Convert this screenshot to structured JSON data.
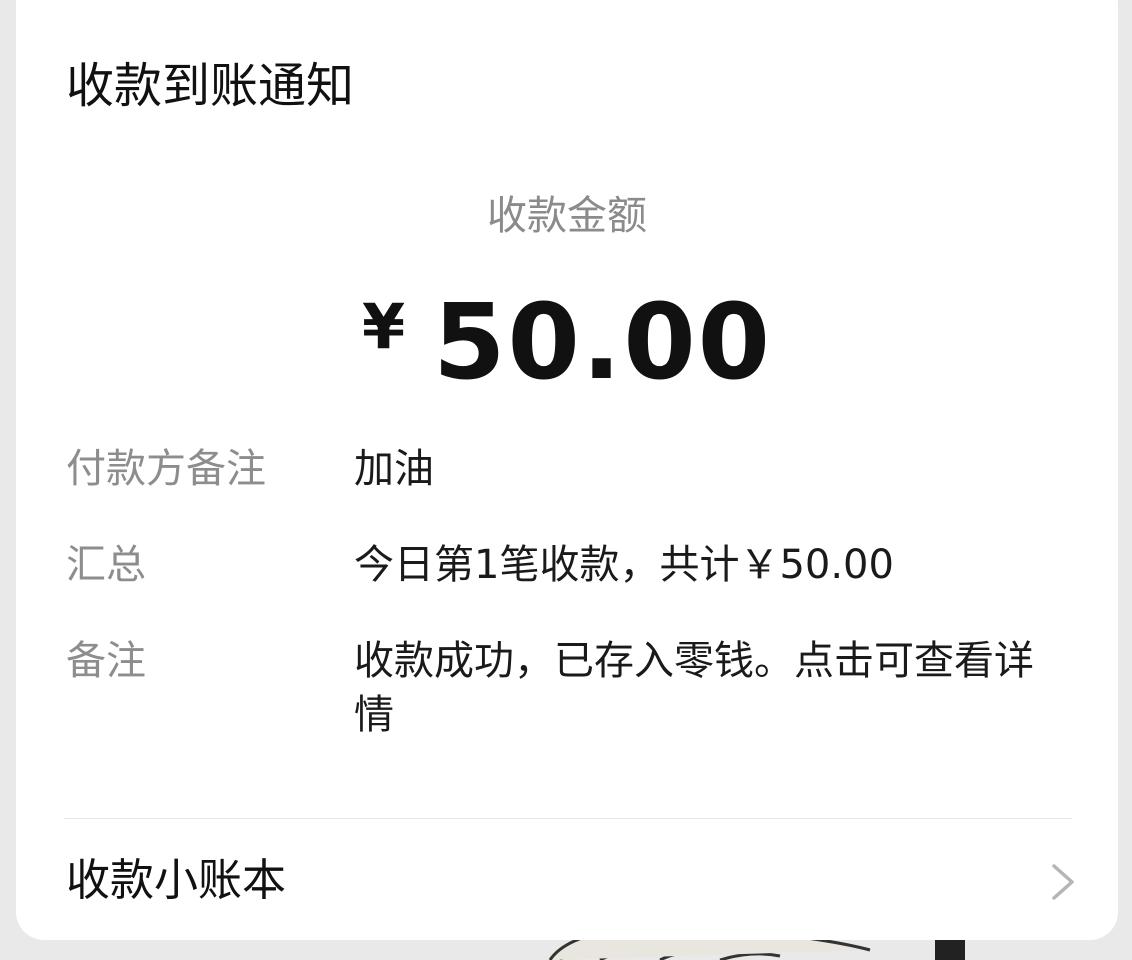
{
  "card": {
    "title": "收款到账通知",
    "amount_label": "收款金额",
    "currency_symbol": "¥",
    "amount": "50.00",
    "rows": [
      {
        "label": "付款方备注",
        "value": "加油"
      },
      {
        "label": "汇总",
        "value": "今日第1笔收款，共计￥50.00"
      },
      {
        "label": "备注",
        "value": "收款成功，已存入零钱。点击可查看详情"
      }
    ],
    "ledger_label": "收款小账本"
  },
  "icons": {
    "chevron": "chevron-right-icon"
  },
  "colors": {
    "background": "#e9e9e9",
    "card": "#ffffff",
    "primary_text": "#111111",
    "secondary_text": "#8d8d8d"
  }
}
